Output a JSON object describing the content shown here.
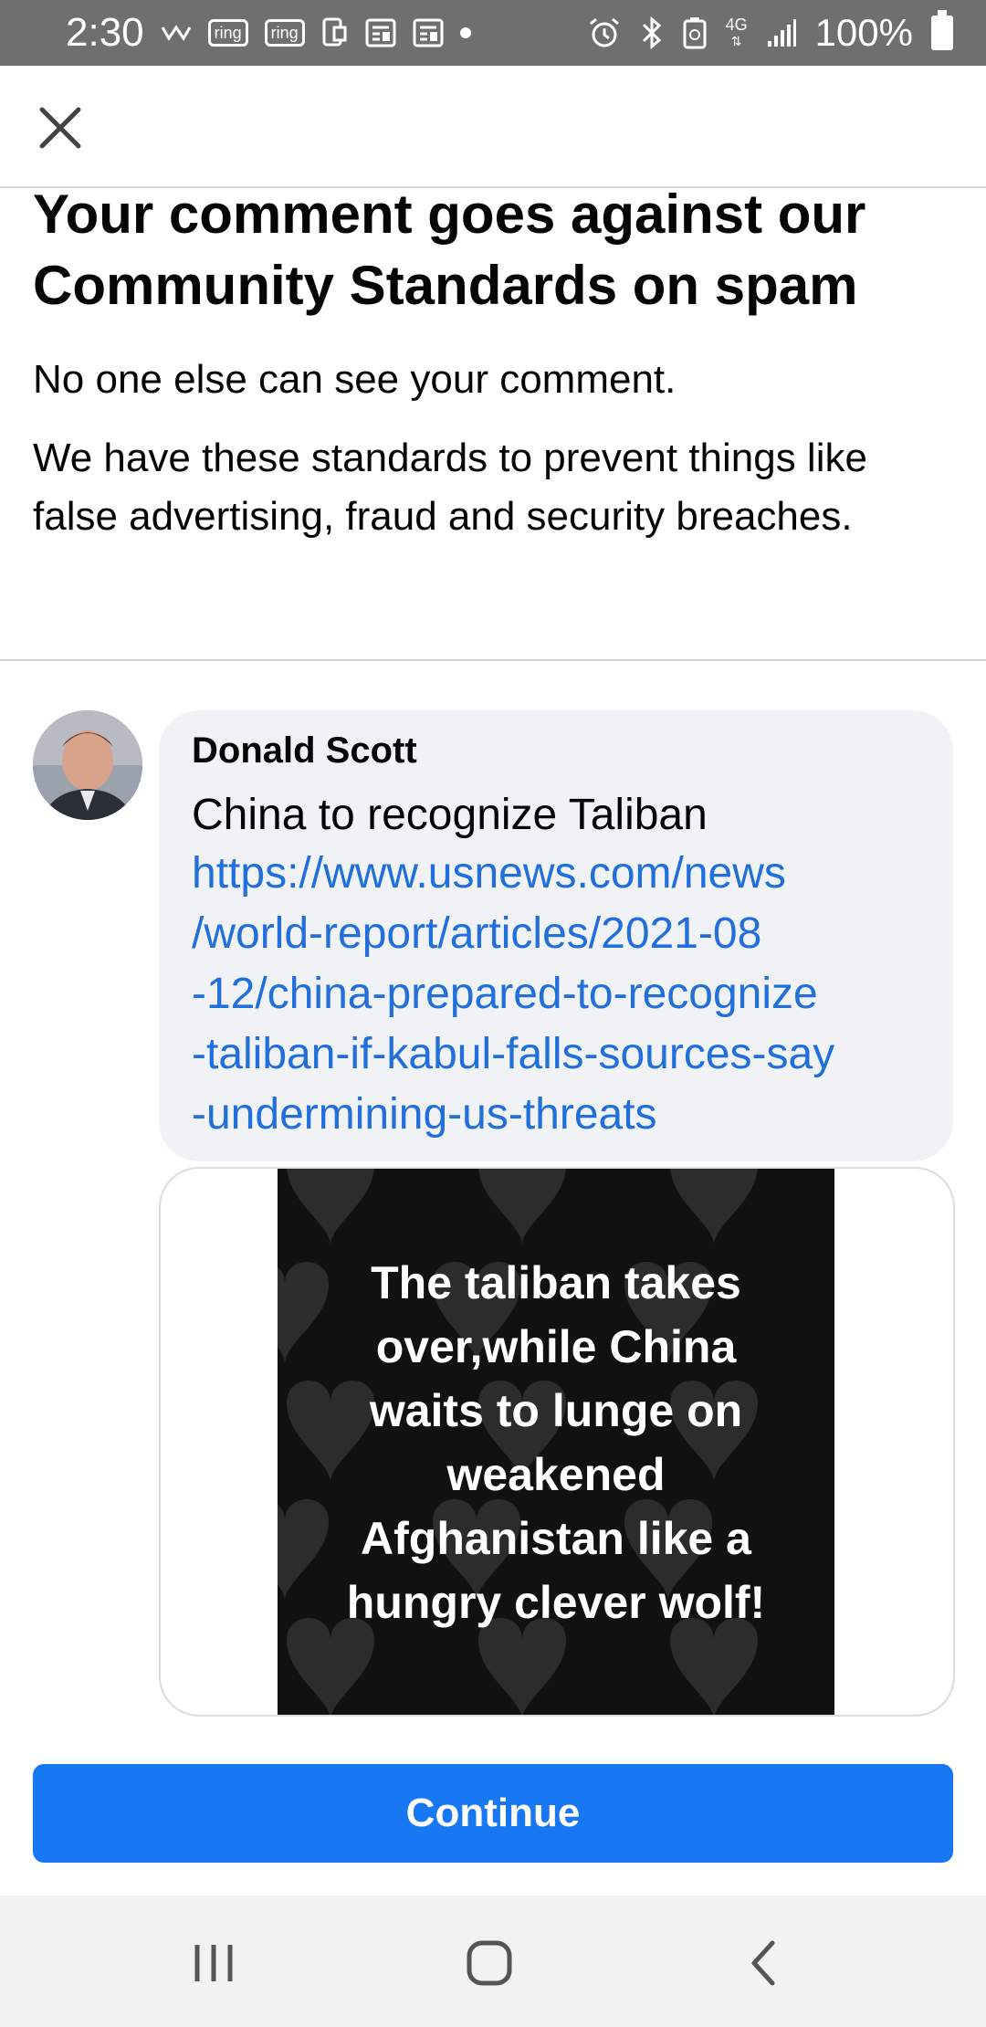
{
  "status_bar": {
    "time": "2:30",
    "icons": [
      "vw-icon",
      "ring-icon",
      "ring-icon",
      "phone-icon",
      "news-icon",
      "news-icon",
      "dot-icon",
      "alarm-icon",
      "bluetooth-icon",
      "battery-saver-icon",
      "4g-icon",
      "signal-icon"
    ],
    "ring_label": "ring",
    "network_label": "4G",
    "battery_percent": "100%"
  },
  "dialog": {
    "title": "Your comment goes against our Community Standards on spam",
    "subtitle": "No one else can see your comment.",
    "explanation": "We have these standards to prevent things like false advertising, fraud and security breaches."
  },
  "comment": {
    "author": "Donald Scott",
    "text": "China to recognize Taliban",
    "link_lines": [
      "https://www.usnews.com/news",
      "/world-report/articles/2021-08",
      "-12/china-prepared-to-recognize",
      "-taliban-if-kabul-falls-sources-say",
      "-undermining-us-threats"
    ],
    "attachment_text_lines": [
      "The taliban takes",
      "over,while China",
      "waits to lunge on",
      "weakened",
      "Afghanistan like a",
      "hungry clever wolf!"
    ]
  },
  "actions": {
    "continue_label": "Continue"
  },
  "colors": {
    "accent": "#1877f2",
    "link": "#216fdb",
    "bubble": "#f0f2f5",
    "status_bar": "#6f6f6f"
  }
}
